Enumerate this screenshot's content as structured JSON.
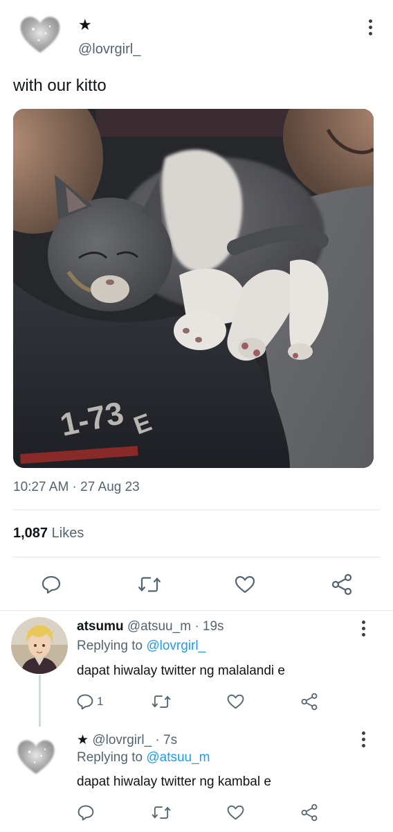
{
  "tweet": {
    "display_name": "★",
    "handle": "@lovrgirl_",
    "text": "with our kitto",
    "timestamp": "10:27 AM · 27 Aug 23",
    "likes_count": "1,087",
    "likes_label": "Likes",
    "photo_caption_text": "1-73"
  },
  "replies": [
    {
      "name": "atsumu",
      "handle": "@atsuu_m",
      "sep": "·",
      "time": "19s",
      "replying_prefix": "Replying to",
      "replying_to": "@lovrgirl_",
      "text": "dapat hiwalay twitter ng malalandi e",
      "reply_count": "1"
    },
    {
      "name": "★",
      "handle": "@lovrgirl_",
      "sep": "·",
      "time": "7s",
      "replying_prefix": "Replying to",
      "replying_to": "@atsuu_m",
      "text": "dapat hiwalay twitter ng kambal e"
    }
  ],
  "icons": {
    "reply": "reply-icon",
    "retweet": "retweet-icon",
    "like": "heart-icon",
    "share": "share-icon",
    "more": "more-icon"
  },
  "colors": {
    "link": "#1d9bf0",
    "secondary_text": "#536471",
    "primary_text": "#0f1419",
    "divider": "#e3e6e8"
  }
}
